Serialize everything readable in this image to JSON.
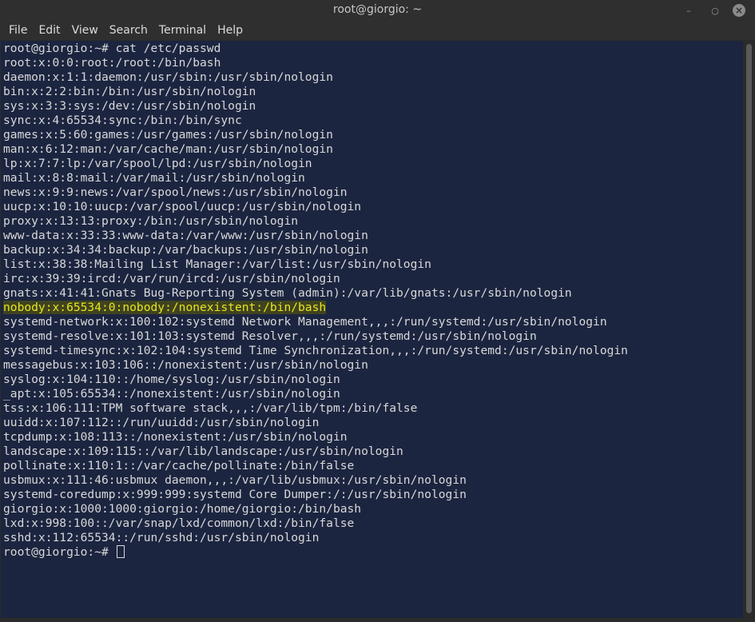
{
  "window": {
    "title": "root@giorgio: ~"
  },
  "menu": [
    "File",
    "Edit",
    "View",
    "Search",
    "Terminal",
    "Help"
  ],
  "terminal": {
    "lines": [
      {
        "text": "root@giorgio:~# cat /etc/passwd",
        "highlight": false
      },
      {
        "text": "root:x:0:0:root:/root:/bin/bash",
        "highlight": false
      },
      {
        "text": "daemon:x:1:1:daemon:/usr/sbin:/usr/sbin/nologin",
        "highlight": false
      },
      {
        "text": "bin:x:2:2:bin:/bin:/usr/sbin/nologin",
        "highlight": false
      },
      {
        "text": "sys:x:3:3:sys:/dev:/usr/sbin/nologin",
        "highlight": false
      },
      {
        "text": "sync:x:4:65534:sync:/bin:/bin/sync",
        "highlight": false
      },
      {
        "text": "games:x:5:60:games:/usr/games:/usr/sbin/nologin",
        "highlight": false
      },
      {
        "text": "man:x:6:12:man:/var/cache/man:/usr/sbin/nologin",
        "highlight": false
      },
      {
        "text": "lp:x:7:7:lp:/var/spool/lpd:/usr/sbin/nologin",
        "highlight": false
      },
      {
        "text": "mail:x:8:8:mail:/var/mail:/usr/sbin/nologin",
        "highlight": false
      },
      {
        "text": "news:x:9:9:news:/var/spool/news:/usr/sbin/nologin",
        "highlight": false
      },
      {
        "text": "uucp:x:10:10:uucp:/var/spool/uucp:/usr/sbin/nologin",
        "highlight": false
      },
      {
        "text": "proxy:x:13:13:proxy:/bin:/usr/sbin/nologin",
        "highlight": false
      },
      {
        "text": "www-data:x:33:33:www-data:/var/www:/usr/sbin/nologin",
        "highlight": false
      },
      {
        "text": "backup:x:34:34:backup:/var/backups:/usr/sbin/nologin",
        "highlight": false
      },
      {
        "text": "list:x:38:38:Mailing List Manager:/var/list:/usr/sbin/nologin",
        "highlight": false
      },
      {
        "text": "irc:x:39:39:ircd:/var/run/ircd:/usr/sbin/nologin",
        "highlight": false
      },
      {
        "text": "gnats:x:41:41:Gnats Bug-Reporting System (admin):/var/lib/gnats:/usr/sbin/nologin",
        "highlight": false
      },
      {
        "text": "nobody:x:65534:0:nobody:/nonexistent:/bin/bash",
        "highlight": true
      },
      {
        "text": "systemd-network:x:100:102:systemd Network Management,,,:/run/systemd:/usr/sbin/nologin",
        "highlight": false
      },
      {
        "text": "systemd-resolve:x:101:103:systemd Resolver,,,:/run/systemd:/usr/sbin/nologin",
        "highlight": false
      },
      {
        "text": "systemd-timesync:x:102:104:systemd Time Synchronization,,,:/run/systemd:/usr/sbin/nologin",
        "highlight": false
      },
      {
        "text": "messagebus:x:103:106::/nonexistent:/usr/sbin/nologin",
        "highlight": false
      },
      {
        "text": "syslog:x:104:110::/home/syslog:/usr/sbin/nologin",
        "highlight": false
      },
      {
        "text": "_apt:x:105:65534::/nonexistent:/usr/sbin/nologin",
        "highlight": false
      },
      {
        "text": "tss:x:106:111:TPM software stack,,,:/var/lib/tpm:/bin/false",
        "highlight": false
      },
      {
        "text": "uuidd:x:107:112::/run/uuidd:/usr/sbin/nologin",
        "highlight": false
      },
      {
        "text": "tcpdump:x:108:113::/nonexistent:/usr/sbin/nologin",
        "highlight": false
      },
      {
        "text": "landscape:x:109:115::/var/lib/landscape:/usr/sbin/nologin",
        "highlight": false
      },
      {
        "text": "pollinate:x:110:1::/var/cache/pollinate:/bin/false",
        "highlight": false
      },
      {
        "text": "usbmux:x:111:46:usbmux daemon,,,:/var/lib/usbmux:/usr/sbin/nologin",
        "highlight": false
      },
      {
        "text": "systemd-coredump:x:999:999:systemd Core Dumper:/:/usr/sbin/nologin",
        "highlight": false
      },
      {
        "text": "giorgio:x:1000:1000:giorgio:/home/giorgio:/bin/bash",
        "highlight": false
      },
      {
        "text": "lxd:x:998:100::/var/snap/lxd/common/lxd:/bin/false",
        "highlight": false
      },
      {
        "text": "sshd:x:112:65534::/run/sshd:/usr/sbin/nologin",
        "highlight": false
      }
    ],
    "prompt": "root@giorgio:~# "
  },
  "colors": {
    "terminal_bg": "#1c2540",
    "text": "#d8d8d8",
    "highlight_fg": "#e6e61e",
    "chrome_bg": "#2f2f2f"
  },
  "icons": {
    "minimize": "minimize-icon",
    "maximize": "maximize-icon",
    "close": "close-icon"
  }
}
